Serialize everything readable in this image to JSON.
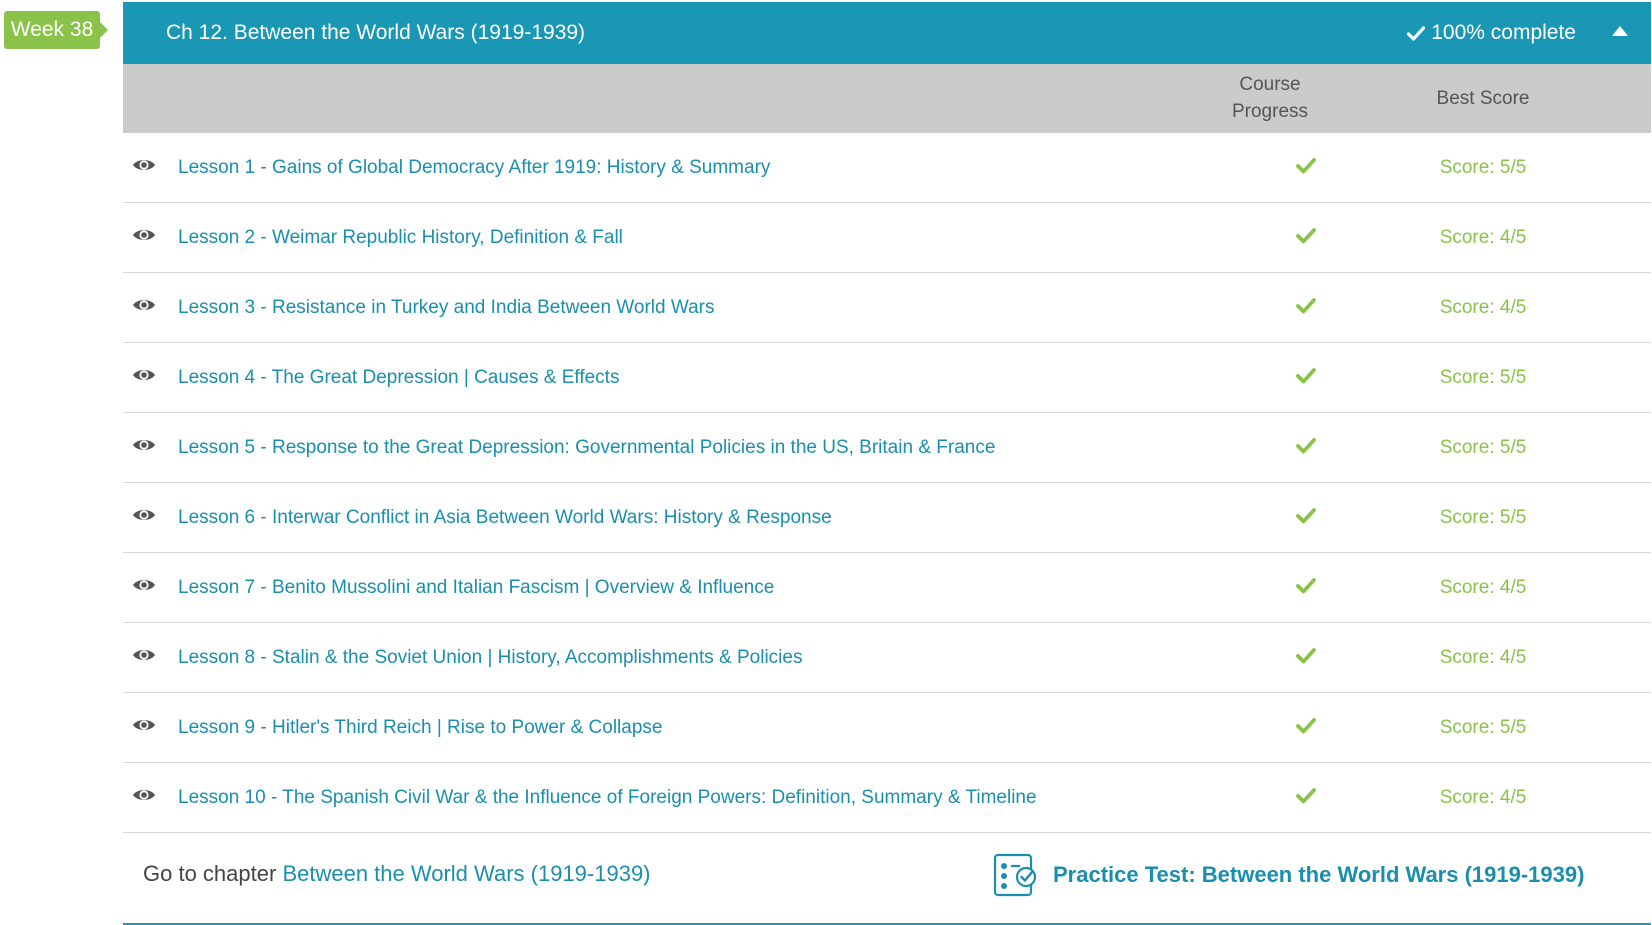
{
  "week_label": "Week 38",
  "chapter": {
    "title": "Ch 12. Between the World Wars (1919-1939)",
    "completion": "100% complete"
  },
  "columns": {
    "progress": "Course Progress",
    "score": "Best Score"
  },
  "lessons": [
    {
      "title": "Lesson 1 - Gains of Global Democracy After 1919: History & Summary",
      "score": "Score: 5/5"
    },
    {
      "title": "Lesson 2 - Weimar Republic History, Definition & Fall",
      "score": "Score: 4/5"
    },
    {
      "title": "Lesson 3 - Resistance in Turkey and India Between World Wars",
      "score": "Score: 4/5"
    },
    {
      "title": "Lesson 4 - The Great Depression | Causes & Effects",
      "score": "Score: 5/5"
    },
    {
      "title": "Lesson 5 - Response to the Great Depression: Governmental Policies in the US, Britain & France",
      "score": "Score: 5/5"
    },
    {
      "title": "Lesson 6 - Interwar Conflict in Asia Between World Wars: History & Response",
      "score": "Score: 5/5"
    },
    {
      "title": "Lesson 7 - Benito Mussolini and Italian Fascism | Overview & Influence",
      "score": "Score: 4/5"
    },
    {
      "title": "Lesson 8 - Stalin & the Soviet Union | History, Accomplishments & Policies",
      "score": "Score: 4/5"
    },
    {
      "title": "Lesson 9 - Hitler's Third Reich | Rise to Power & Collapse",
      "score": "Score: 5/5"
    },
    {
      "title": "Lesson 10 - The Spanish Civil War & the Influence of Foreign Powers: Definition, Summary & Timeline",
      "score": "Score: 4/5"
    }
  ],
  "footer": {
    "goto_prefix": "Go to chapter",
    "goto_link": "Between the World Wars (1919-1939)",
    "practice_test": "Practice Test: Between the World Wars (1919-1939)"
  },
  "colors": {
    "header_bg": "#1a97b5",
    "link": "#1a8fad",
    "success": "#8bc34a",
    "column_header_bg": "#cbcbcb"
  },
  "icons": {
    "row_view": "eye-icon",
    "progress": "checkmark-icon",
    "practice": "practice-test-icon",
    "collapse": "caret-up-icon"
  }
}
